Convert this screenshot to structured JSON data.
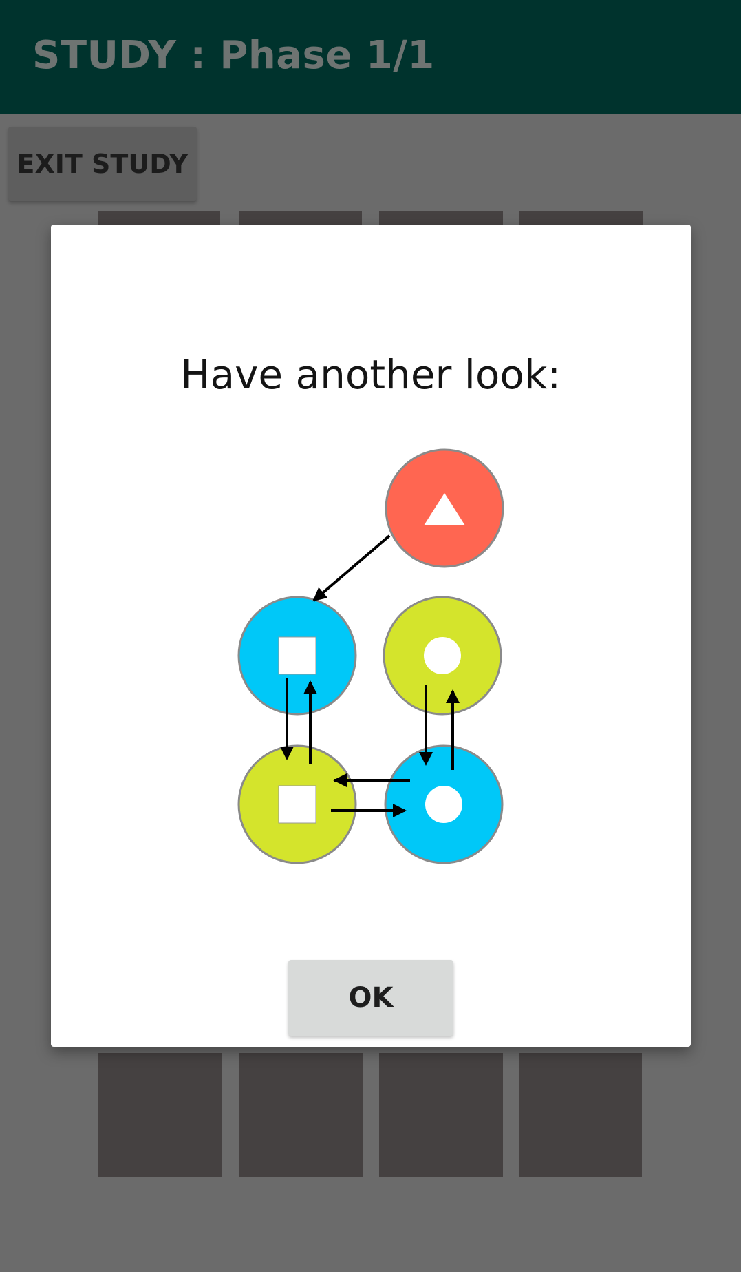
{
  "app_bar": {
    "title": "STUDY : Phase 1/1"
  },
  "toolbar": {
    "exit_label": "EXIT STUDY"
  },
  "dialog": {
    "title": "Have another look:",
    "ok_label": "OK",
    "pattern": {
      "nodes": [
        {
          "row": 0,
          "col": 1,
          "color": "#ff6651",
          "symbol": "triangle"
        },
        {
          "row": 1,
          "col": 0,
          "color": "#00c8f8",
          "symbol": "square"
        },
        {
          "row": 1,
          "col": 1,
          "color": "#d4e42c",
          "symbol": "circle"
        },
        {
          "row": 2,
          "col": 0,
          "color": "#d4e42c",
          "symbol": "square"
        },
        {
          "row": 2,
          "col": 1,
          "color": "#00c8f8",
          "symbol": "circle"
        }
      ],
      "arrow_color": "#000000"
    }
  },
  "colors": {
    "app_bar": "#00332d",
    "scrim": "#6b6b6b",
    "tile": "#454141",
    "dialog": "#ffffff",
    "ok_button": "#d8dad9"
  }
}
